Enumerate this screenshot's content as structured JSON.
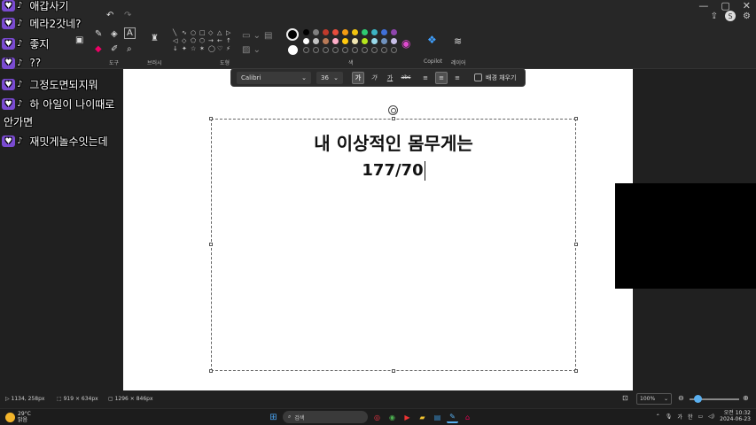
{
  "window": {
    "controls": [
      "—",
      "▢",
      "✕"
    ]
  },
  "ribbon": {
    "groups": [
      "도구",
      "브러시",
      "도형",
      "색",
      "Copilot",
      "레이어"
    ],
    "user_initial": "S",
    "colors": [
      "#000000",
      "#7f7f7f",
      "#c0392b",
      "#e74c3c",
      "#f39c12",
      "#f1c40f",
      "#2ecc71",
      "#3bb3c3",
      "#3f6fd8",
      "#8e44ad",
      "#ffffff",
      "#c3c3c3",
      "#b97a57",
      "#ffaec9",
      "#ffc90e",
      "#efe4b0",
      "#b5e61d",
      "#99d9ea",
      "#7092be",
      "#c8bfe7"
    ],
    "primary_color": "#000000",
    "secondary_color": "#ffffff"
  },
  "text_toolbar": {
    "font": "Calibri",
    "size": "36",
    "bold": "가",
    "italic": "가",
    "underline": "가",
    "strike": "abc",
    "fill_label": "배경 채우기"
  },
  "canvas": {
    "line1": "내 이상적인 몸무게는",
    "line2": "177/70"
  },
  "chat": {
    "messages": [
      {
        "text": "애갑사기"
      },
      {
        "text": "메라2갓네?"
      },
      {
        "text": "좋지"
      },
      {
        "text": "??"
      },
      {
        "text": "그정도면되지뭐"
      },
      {
        "text": "하 아일이 나이때로"
      },
      {
        "text": "재밋게놀수잇는데"
      }
    ],
    "wrap_text": "안가면"
  },
  "statusbar": {
    "cursor": "1134, 258px",
    "selection": "919 × 634px",
    "canvas_size": "1296 × 846px",
    "zoom": "100%"
  },
  "taskbar": {
    "temperature": "29°C",
    "weather": "맑음",
    "search_placeholder": "검색",
    "ime": "가",
    "lang": "한",
    "time": "오전 10:32",
    "date": "2024-06-23"
  }
}
